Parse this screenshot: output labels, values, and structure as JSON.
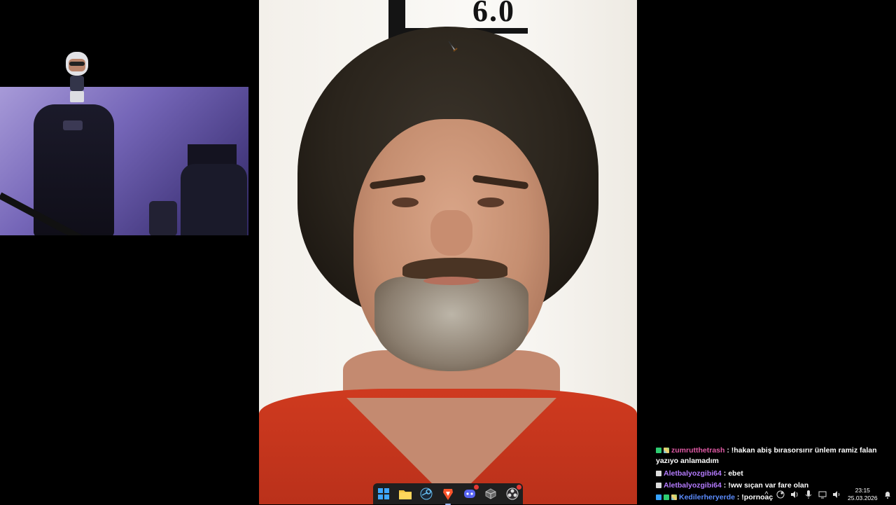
{
  "photo": {
    "board_text": "6.0"
  },
  "chat": [
    {
      "user": "zumrutthetrash",
      "text": ": !hakan abiş bırasorsırır ünlem ramiz falan yazıyo anlamadım",
      "user_color": "#e05aa5",
      "badges": [
        "k",
        "pixel"
      ]
    },
    {
      "user": "Aletbalyozgibi64",
      "text": ": ebet",
      "user_color": "#b57bff",
      "badges": [
        "k"
      ]
    },
    {
      "user": "Aletbalyozgibi64",
      "text": ": !ww sıçan var fare olan",
      "user_color": "#b57bff",
      "badges": [
        "k"
      ]
    },
    {
      "user": "Kedilerheryerde",
      "text": ": !pornoaç",
      "user_color": "#5b8cff",
      "badges": [
        "cube",
        "k",
        "pixel"
      ]
    }
  ],
  "taskbar": {
    "icons": [
      "windows-start-icon",
      "file-explorer-icon",
      "steam-icon",
      "brave-browser-icon",
      "discord-icon",
      "cube-app-icon",
      "obs-icon"
    ],
    "active": "brave-browser-icon",
    "discord_badge": "9"
  },
  "tray": {
    "time": "23:15",
    "date": "25.03.2026"
  },
  "colors": {
    "taskbar_bg": "#1f1f1f",
    "shirt": "#cf3a1f",
    "webcam_tint": "#7566b8"
  }
}
